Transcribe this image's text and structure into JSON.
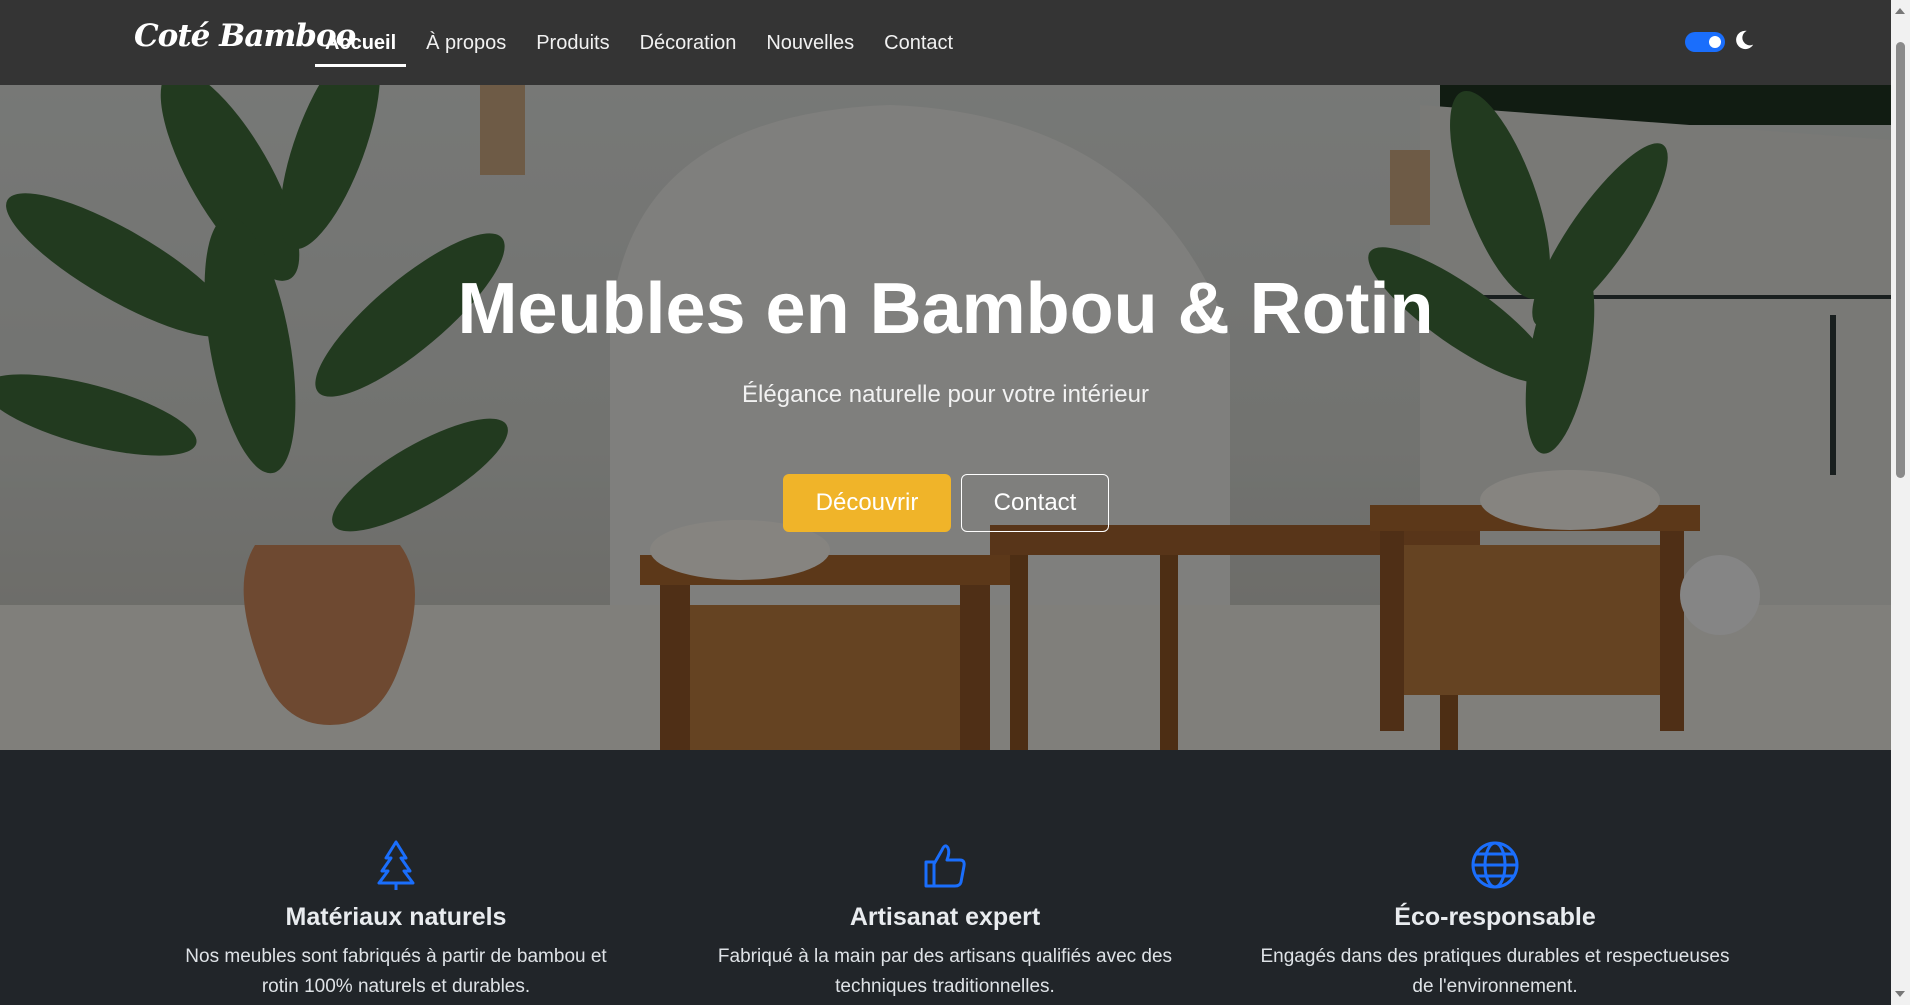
{
  "brand": "Coté Bamboo",
  "nav": {
    "items": [
      {
        "label": "Accueil",
        "active": true
      },
      {
        "label": "À propos",
        "active": false
      },
      {
        "label": "Produits",
        "active": false
      },
      {
        "label": "Décoration",
        "active": false
      },
      {
        "label": "Nouvelles",
        "active": false
      },
      {
        "label": "Contact",
        "active": false
      }
    ],
    "theme_toggle": "on",
    "theme_icon": "moon-icon"
  },
  "hero": {
    "title": "Meubles en Bambou & Rotin",
    "subtitle": "Élégance naturelle pour votre intérieur",
    "primary_button": "Découvrir",
    "secondary_button": "Contact"
  },
  "features": [
    {
      "icon": "tree-icon",
      "title": "Matériaux naturels",
      "text_line1": "Nos meubles sont fabriqués à partir de bambou et",
      "text_line2": "rotin 100% naturels et durables."
    },
    {
      "icon": "thumbs-up-icon",
      "title": "Artisanat expert",
      "text_line1": "Fabriqué à la main par des artisans qualifiés avec des",
      "text_line2": "techniques traditionnelles."
    },
    {
      "icon": "globe-icon",
      "title": "Éco-responsable",
      "text_line1": "Engagés dans des pratiques durables et respectueuses",
      "text_line2": "de l'environnement."
    }
  ],
  "colors": {
    "accent": "#f0b429",
    "icon_blue": "#1a6efc",
    "navbar": "#343434",
    "dark_bg": "#212529"
  }
}
